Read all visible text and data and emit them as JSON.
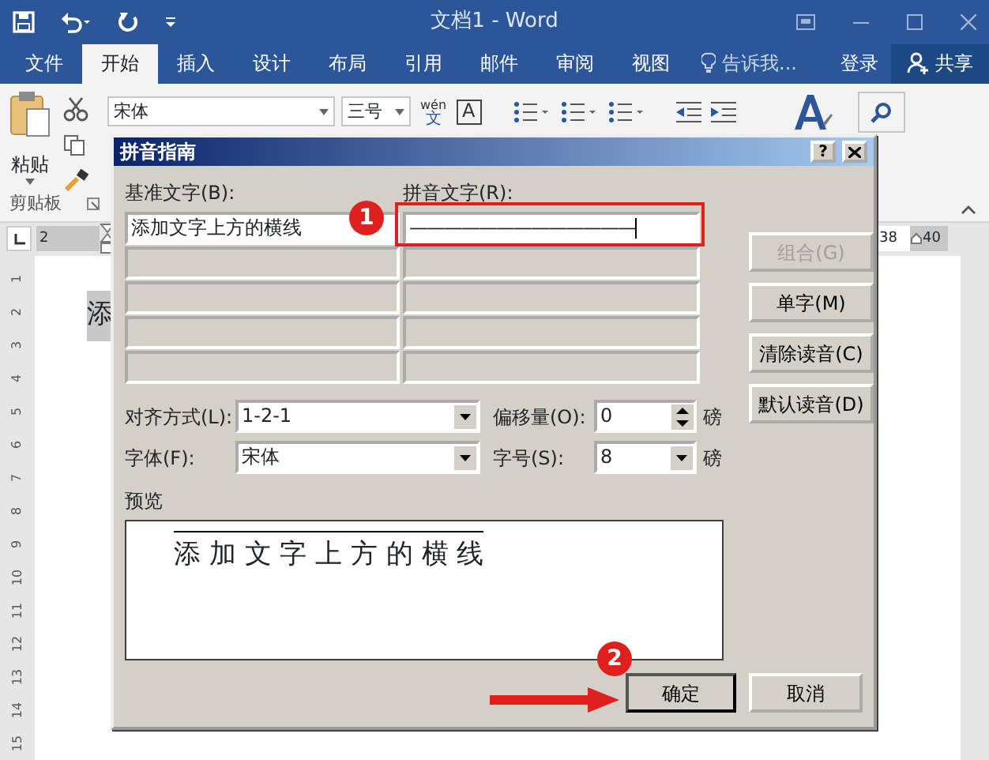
{
  "window": {
    "title": "文档1 - Word"
  },
  "ribbon_tabs": [
    {
      "label": "文件",
      "selected": false
    },
    {
      "label": "开始",
      "selected": true
    },
    {
      "label": "插入",
      "selected": false
    },
    {
      "label": "设计",
      "selected": false
    },
    {
      "label": "布局",
      "selected": false
    },
    {
      "label": "引用",
      "selected": false
    },
    {
      "label": "邮件",
      "selected": false
    },
    {
      "label": "审阅",
      "selected": false
    },
    {
      "label": "视图",
      "selected": false
    }
  ],
  "tell_me": "告诉我...",
  "sign_in": "登录",
  "share": "共享",
  "ribbon": {
    "paste": "粘贴",
    "clipboard_group": "剪贴板",
    "font_name": "宋体",
    "font_size": "三号",
    "phonetic_pinyin": "wén",
    "phonetic_char": "文",
    "char_border": "A"
  },
  "ruler": {
    "left_mark": "2",
    "right_marks": [
      "38",
      "40"
    ],
    "vertical_marks": [
      "1",
      "2",
      "3",
      "4",
      "5",
      "6",
      "7",
      "8",
      "9",
      "10",
      "11",
      "12",
      "13",
      "14",
      "15"
    ]
  },
  "document": {
    "visible_text": "添"
  },
  "dialog": {
    "title": "拼音指南",
    "help": "?",
    "base_label": "基准文字(B):",
    "ruby_label": "拼音文字(R):",
    "rows": [
      {
        "base": "添加文字上方的横线",
        "ruby": "—————————————"
      }
    ],
    "side_buttons": [
      {
        "label": "组合(G)",
        "disabled": true
      },
      {
        "label": "单字(M)",
        "disabled": false
      },
      {
        "label": "清除读音(C)",
        "disabled": false
      },
      {
        "label": "默认读音(D)",
        "disabled": false
      }
    ],
    "alignment": {
      "label": "对齐方式(L):",
      "value": "1-2-1"
    },
    "offset": {
      "label": "偏移量(O):",
      "value": "0",
      "unit": "磅"
    },
    "font": {
      "label": "字体(F):",
      "value": "宋体"
    },
    "size": {
      "label": "字号(S):",
      "value": "8",
      "unit": "磅"
    },
    "preview": {
      "label": "预览",
      "text": "添 加 文 字 上 方 的 横 线"
    },
    "footer_buttons": [
      "确定",
      "取消"
    ]
  },
  "callouts": [
    {
      "label": "1"
    },
    {
      "label": "2"
    }
  ]
}
